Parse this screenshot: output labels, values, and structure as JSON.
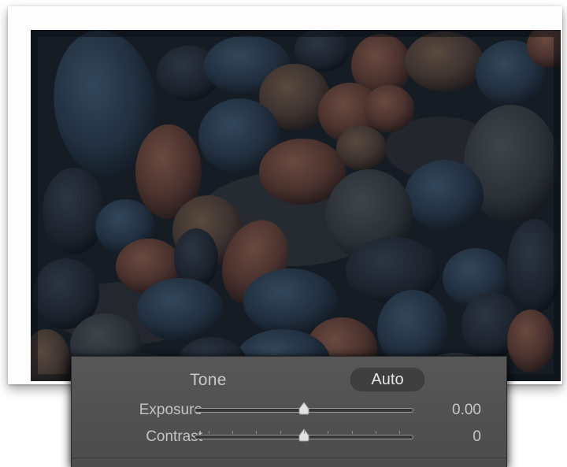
{
  "photo": {
    "subject": "dark-pebbles"
  },
  "tone_panel": {
    "title": "Tone",
    "auto_label": "Auto",
    "sliders": [
      {
        "label": "Exposure",
        "value_text": "0.00",
        "level": 0.5,
        "show_ticks": false
      },
      {
        "label": "Contrast",
        "value_text": "0",
        "level": 0.5,
        "show_ticks": true
      }
    ]
  },
  "colors": {
    "panel_bg": "#505050",
    "photo_base": "#141a22",
    "text": "#c8c8c8"
  }
}
